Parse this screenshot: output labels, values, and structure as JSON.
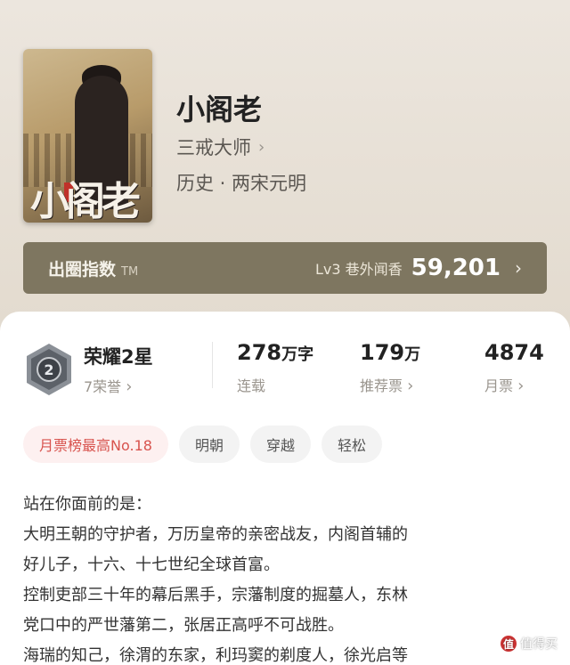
{
  "book": {
    "title": "小阁老",
    "author": "三戒大师",
    "genre": "历史 · 两宋元明",
    "cover_text": "小阁老"
  },
  "index_bar": {
    "label": "出圈指数",
    "tm": "TM",
    "level": "Lv3 巷外闻香",
    "value": "59,201"
  },
  "honor": {
    "title": "荣耀2星",
    "subtitle": "7荣誉",
    "badge_number": "2"
  },
  "stats": [
    {
      "value": "278",
      "unit": "万字",
      "label": "连载"
    },
    {
      "value": "179",
      "unit": "万",
      "label": "推荐票"
    },
    {
      "value": "4874",
      "unit": "",
      "label": "月票"
    }
  ],
  "tags": [
    "月票榜最高No.18",
    "明朝",
    "穿越",
    "轻松"
  ],
  "intro": [
    "站在你面前的是：",
    "大明王朝的守护者，万历皇帝的亲密战友，内阁首辅的",
    "好儿子，十六、十七世纪全球首富。",
    "控制吏部三十年的幕后黑手，宗藩制度的掘墓人，东林",
    "党口中的严世藩第二，张居正高呼不可战胜。",
    "海瑞的知己，徐渭的东家，利玛窦的剃度人，徐光启等"
  ],
  "watermark": "值得买",
  "colors": {
    "accent_red": "#d8534e",
    "index_bar_bg": "#7e7660",
    "header_bg": "#e8e1d7"
  }
}
